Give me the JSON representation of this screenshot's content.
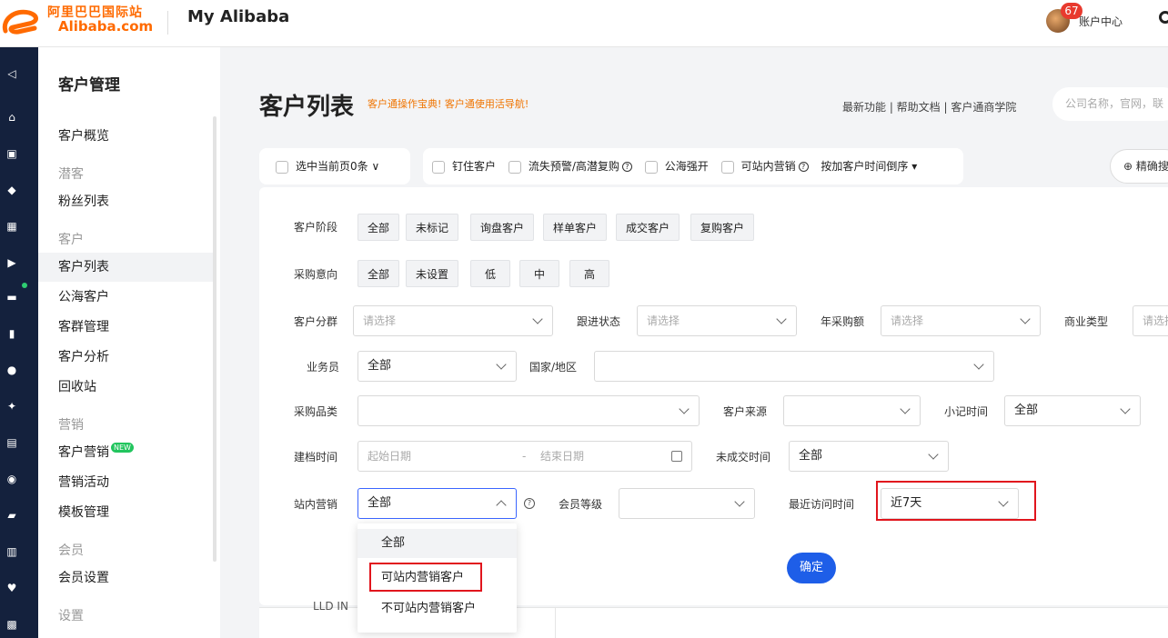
{
  "header": {
    "logo_cn": "阿里巴巴国际站",
    "logo_en": "Alibaba.com",
    "app_title": "My Alibaba",
    "badge_count": "67",
    "account_label": "账户中心"
  },
  "sidebar": {
    "heading": "客户管理",
    "items": [
      {
        "label": "客户概览"
      },
      {
        "label": "潜客"
      },
      {
        "label": "粉丝列表"
      },
      {
        "label": "客户"
      },
      {
        "label": "客户列表"
      },
      {
        "label": "公海客户"
      },
      {
        "label": "客群管理"
      },
      {
        "label": "客户分析"
      },
      {
        "label": "回收站"
      },
      {
        "label": "营销"
      },
      {
        "label": "客户营销"
      },
      {
        "label": "营销活动"
      },
      {
        "label": "模板管理"
      },
      {
        "label": "会员"
      },
      {
        "label": "会员设置"
      },
      {
        "label": "设置"
      }
    ],
    "new_tag": "NEW"
  },
  "main": {
    "title": "客户列表",
    "guide": "客户通操作宝典! 客户通使用活导航!",
    "links": "最新功能 | 帮助文档 | 客户通商学院",
    "search_placeholder": "公司名称，官网，联",
    "select_page": "选中当前页0条 ∨",
    "toolbar": [
      "钉住客户",
      "流失预警/高潜复购",
      "公海强开",
      "可站内营销"
    ],
    "sort": "按加客户时间倒序 ▾",
    "precise_search": "精确搜"
  },
  "filters": {
    "stage": {
      "label": "客户阶段",
      "options": [
        "全部",
        "未标记",
        "询盘客户",
        "样单客户",
        "成交客户",
        "复购客户"
      ]
    },
    "intent": {
      "label": "采购意向",
      "options": [
        "全部",
        "未设置",
        "低",
        "中",
        "高"
      ]
    },
    "group": {
      "label": "客户分群",
      "placeholder": "请选择"
    },
    "follow": {
      "label": "跟进状态",
      "placeholder": "请选择"
    },
    "annual": {
      "label": "年采购额",
      "placeholder": "请选择"
    },
    "biz_type": {
      "label": "商业类型",
      "placeholder": "请选择"
    },
    "salesperson": {
      "label": "业务员",
      "value": "全部"
    },
    "country": {
      "label": "国家/地区",
      "value": ""
    },
    "category": {
      "label": "采购品类",
      "value": ""
    },
    "source": {
      "label": "客户来源",
      "value": ""
    },
    "note_time": {
      "label": "小记时间",
      "value": "全部"
    },
    "created": {
      "label": "建档时间",
      "start": "起始日期",
      "sep": "-",
      "end": "结束日期"
    },
    "no_deal": {
      "label": "未成交时间",
      "value": "全部"
    },
    "marketing": {
      "label": "站内营销",
      "value": "全部"
    },
    "member": {
      "label": "会员等级",
      "value": ""
    },
    "last_visit": {
      "label": "最近访问时间",
      "value": "近7天"
    },
    "confirm": "确定",
    "marketing_menu": [
      "全部",
      "可站内营销客户",
      "不可站内营销客户"
    ]
  },
  "behind": {
    "text": "LLD IN"
  },
  "colors": {
    "accent": "#1e5ee8",
    "brand": "#ff6a00",
    "highlight": "#e1151d",
    "rail": "#14213d"
  }
}
